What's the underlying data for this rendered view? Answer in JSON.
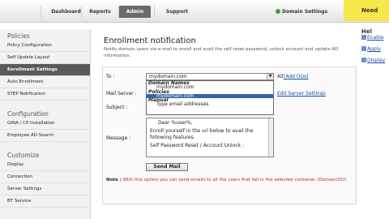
{
  "topnav": {
    "tabs": [
      "Dashboard",
      "Reports",
      "Admin",
      "Support"
    ],
    "domain_settings": "Domain Settings",
    "need_help": "Need Hel"
  },
  "sidebar": {
    "sections": [
      {
        "title": "Policies",
        "items": [
          "Policy Configuration",
          "Self Update Layout",
          "Enrollment Settings",
          "Auto Enrollment",
          "STEP Notification"
        ]
      },
      {
        "title": "Configuration",
        "items": [
          "GINA / CP Installation",
          "Employee AD Search"
        ]
      },
      {
        "title": "Customize",
        "items": [
          "Display",
          "Connection",
          "Server Settings",
          "BT Service"
        ]
      }
    ]
  },
  "main": {
    "title": "Enrollment notification",
    "description": "Notify domain users via e-mail to enroll and avail the self reset password, unlock account and update AD information.",
    "to_label": "To :",
    "mail_server_label": "Mail Server :",
    "subject_label": "Subject :",
    "message_label": "Message :",
    "to_select_value": "mydomain.com",
    "all_text": "All",
    "add_ous": "[Add OUs]",
    "edit_server_settings": "Edit Server Settings",
    "dropdown": {
      "group1": "Domain Names",
      "opt1": "mydomain.com",
      "group2": "Policies",
      "opt2": "mydomain.com",
      "group3": "Manual",
      "opt3": "Type email addresses"
    },
    "message_lines": [
      "Dear %user%,",
      "Enroll yourself in the url below to avail the following features.",
      "Self Password Reset / Account Unlock :"
    ],
    "send_button": "Send Mail",
    "note_label": "Note :",
    "note_text": "With this option you can send emails to all the users that fall in the selected container (Domain/OU)."
  },
  "right_links": [
    "Enable",
    "Apply",
    "Display"
  ]
}
